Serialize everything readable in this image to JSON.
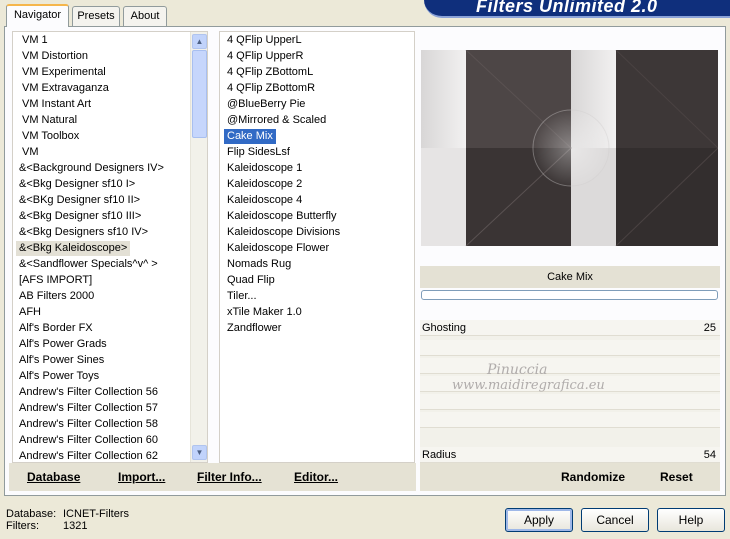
{
  "banner": "Filters Unlimited 2.0",
  "tabs": [
    {
      "label": "Navigator"
    },
    {
      "label": "Presets"
    },
    {
      "label": "About"
    }
  ],
  "categories": [
    "VM 1",
    "VM Distortion",
    "VM Experimental",
    "VM Extravaganza",
    "VM Instant Art",
    "VM Natural",
    "VM Toolbox",
    "VM",
    "&<Background Designers IV>",
    "&<Bkg Designer sf10 I>",
    "&<BKg Designer sf10 II>",
    "&<Bkg Designer sf10 III>",
    "&<Bkg Designers sf10 IV>",
    "&<Bkg Kaleidoscope>",
    "&<Sandflower Specials^v^ >",
    "[AFS IMPORT]",
    "AB Filters 2000",
    "AFH",
    "Alf's Border FX",
    "Alf's Power Grads",
    "Alf's Power Sines",
    "Alf's Power Toys",
    "Andrew's Filter Collection 56",
    "Andrew's Filter Collection 57",
    "Andrew's Filter Collection 58",
    "Andrew's Filter Collection 60",
    "Andrew's Filter Collection 62"
  ],
  "filters": [
    "4 QFlip UpperL",
    "4 QFlip UpperR",
    "4 QFlip ZBottomL",
    "4 QFlip ZBottomR",
    "@BlueBerry Pie",
    "@Mirrored & Scaled",
    "Cake Mix",
    "Flip SidesLsf",
    "Kaleidoscope 1",
    "Kaleidoscope 2",
    "Kaleidoscope 4",
    "Kaleidoscope Butterfly",
    "Kaleidoscope Divisions",
    "Kaleidoscope Flower",
    "Nomads Rug",
    "Quad Flip",
    "Tiler...",
    "xTile Maker 1.0",
    "Zandflower"
  ],
  "left_buttons": {
    "database": "Database",
    "import": "Import...",
    "filter_info": "Filter Info...",
    "editor": "Editor..."
  },
  "selected_filter": "Cake Mix",
  "watermark": {
    "line1": "Pinuccia",
    "line2": "www.maidiregrafica.eu"
  },
  "params": {
    "ghosting_label": "Ghosting",
    "ghosting_value": "25",
    "radius_label": "Radius",
    "radius_value": "54"
  },
  "right_buttons": {
    "randomize": "Randomize",
    "reset": "Reset"
  },
  "status": {
    "database_label": "Database:",
    "database_value": "ICNET-Filters",
    "filters_label": "Filters:",
    "filters_value": "1321"
  },
  "buttons": {
    "apply": "Apply",
    "cancel": "Cancel",
    "help": "Help"
  }
}
